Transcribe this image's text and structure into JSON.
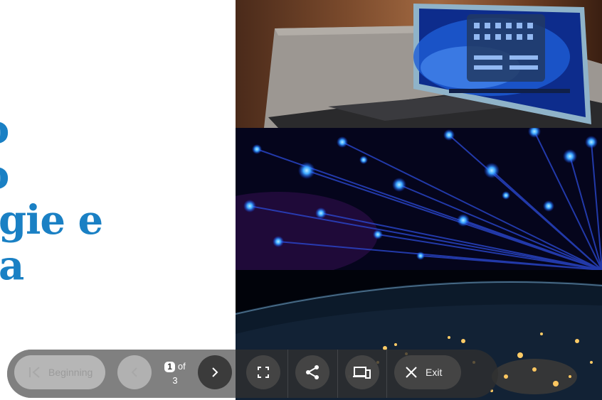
{
  "slide": {
    "title_lines": [
      "o",
      "o",
      "gie e",
      "a"
    ]
  },
  "toolbar": {
    "beginning_label": "Beginning",
    "current_slide": "1",
    "of_label": "of",
    "total_slides": "3",
    "exit_label": "Exit"
  },
  "colors": {
    "title": "#1a80c4",
    "toolbar_dark": "#303030",
    "next_button": "#3b3b3b"
  },
  "icons": {
    "beginning": "skip-to-start-icon",
    "previous": "chevron-left-icon",
    "next": "chevron-right-icon",
    "fullscreen": "fullscreen-icon",
    "share": "share-icon",
    "devices": "devices-icon",
    "exit": "close-icon"
  }
}
